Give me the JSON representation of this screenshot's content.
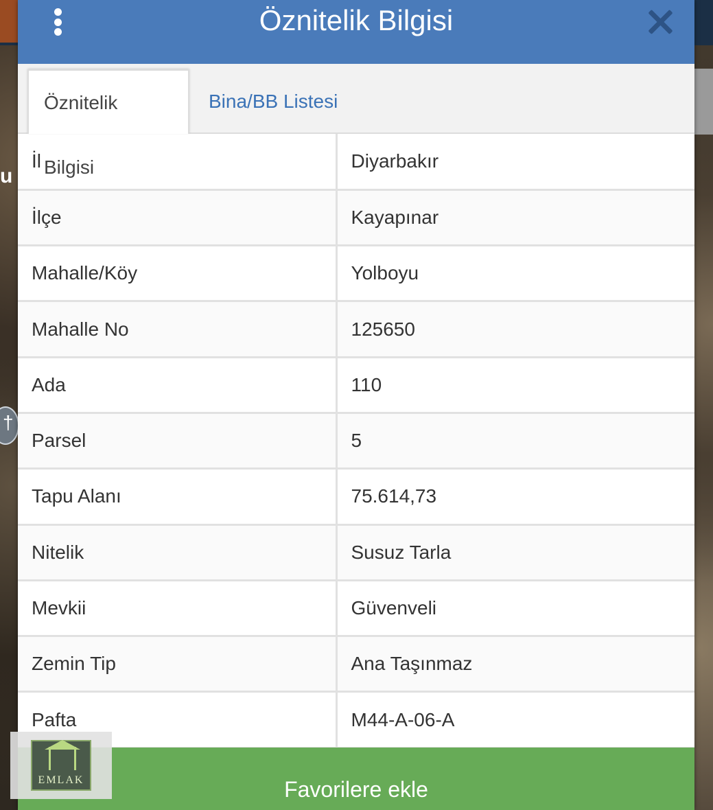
{
  "dialog": {
    "title": "Öznitelik Bilgisi",
    "header_color": "#4a7bba"
  },
  "tabs": [
    {
      "label": "Öznitelik Bilgisi",
      "active": true
    },
    {
      "label": "Bina/BB Listesi",
      "active": false
    }
  ],
  "attributes": [
    {
      "key": "İl",
      "value": "Diyarbakır"
    },
    {
      "key": "İlçe",
      "value": "Kayapınar"
    },
    {
      "key": "Mahalle/Köy",
      "value": "Yolboyu"
    },
    {
      "key": "Mahalle No",
      "value": "125650"
    },
    {
      "key": "Ada",
      "value": "110"
    },
    {
      "key": "Parsel",
      "value": "5"
    },
    {
      "key": "Tapu Alanı",
      "value": "75.614,73"
    },
    {
      "key": "Nitelik",
      "value": "Susuz Tarla"
    },
    {
      "key": "Mevkii",
      "value": "Güvenveli"
    },
    {
      "key": "Zemin Tip",
      "value": "Ana Taşınmaz"
    },
    {
      "key": "Pafta",
      "value": "M44-A-06-A"
    }
  ],
  "footer": {
    "favorite_label": "Favorilere ekle",
    "button_color": "#67ab57"
  },
  "logo": {
    "text": "EMLAK"
  },
  "map": {
    "label_fragment": "u"
  }
}
